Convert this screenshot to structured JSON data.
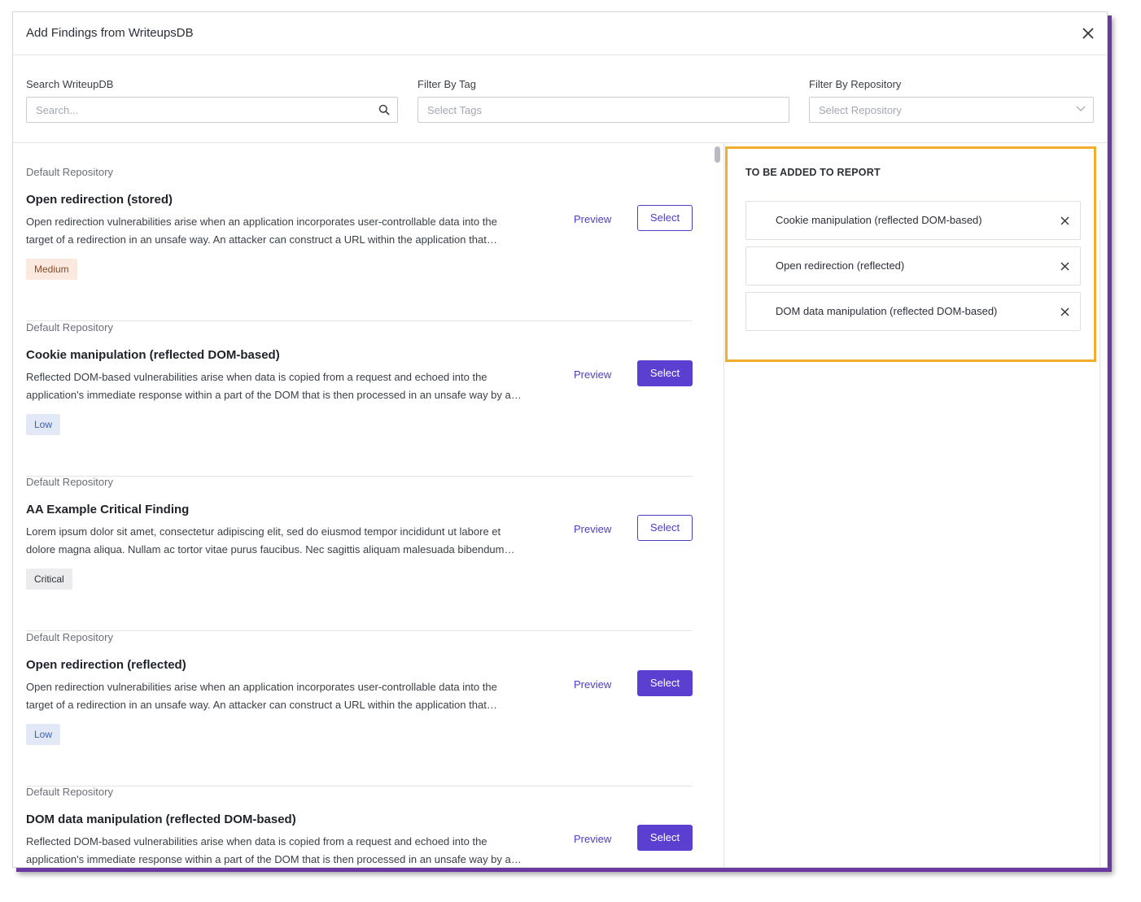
{
  "modal": {
    "title": "Add Findings from WriteupsDB",
    "close_icon": "close-icon"
  },
  "filters": {
    "search": {
      "label": "Search WriteupDB",
      "placeholder": "Search..."
    },
    "tag": {
      "label": "Filter By Tag",
      "placeholder": "Select Tags"
    },
    "repository": {
      "label": "Filter By Repository",
      "placeholder": "Select Repository"
    }
  },
  "findings": [
    {
      "repo": "Default Repository",
      "title": "Open redirection (stored)",
      "desc_line1": "Open redirection vulnerabilities arise when an application incorporates user-controllable data into the",
      "desc_line2": "target of a redirection in an unsafe way. An attacker can construct a URL within the application that…",
      "severity": "Medium",
      "preview": "Preview",
      "select": "Select",
      "selected": false
    },
    {
      "repo": "Default Repository",
      "title": "Cookie manipulation (reflected DOM-based)",
      "desc_line1": "Reflected DOM-based vulnerabilities arise when data is copied from a request and echoed into the",
      "desc_line2": "application's immediate response within a part of the DOM that is then processed in an unsafe way by a…",
      "severity": "Low",
      "preview": "Preview",
      "select": "Select",
      "selected": true
    },
    {
      "repo": "Default Repository",
      "title": "AA Example Critical Finding",
      "desc_line1": "Lorem ipsum dolor sit amet, consectetur adipiscing elit, sed do eiusmod tempor incididunt ut labore et",
      "desc_line2": "dolore magna aliqua. Nullam ac tortor vitae purus faucibus. Nec sagittis aliquam malesuada bibendum…",
      "severity": "Critical",
      "preview": "Preview",
      "select": "Select",
      "selected": false
    },
    {
      "repo": "Default Repository",
      "title": "Open redirection (reflected)",
      "desc_line1": "Open redirection vulnerabilities arise when an application incorporates user-controllable data into the",
      "desc_line2": "target of a redirection in an unsafe way. An attacker can construct a URL within the application that…",
      "severity": "Low",
      "preview": "Preview",
      "select": "Select",
      "selected": true
    },
    {
      "repo": "Default Repository",
      "title": "DOM data manipulation (reflected DOM-based)",
      "desc_line1": "Reflected DOM-based vulnerabilities arise when data is copied from a request and echoed into the",
      "desc_line2": "application's immediate response within a part of the DOM that is then processed in an unsafe way by a…",
      "severity": "",
      "preview": "Preview",
      "select": "Select",
      "selected": true
    }
  ],
  "to_be_added": {
    "heading": "TO BE ADDED TO REPORT",
    "items": [
      {
        "label": "Cookie manipulation (reflected DOM-based)"
      },
      {
        "label": "Open redirection (reflected)"
      },
      {
        "label": "DOM data manipulation (reflected DOM-based)"
      }
    ]
  },
  "colors": {
    "accent": "#5b3fd1",
    "highlight": "#f1ad2e",
    "medium_badge_bg": "#fbe9df",
    "low_badge_bg": "#e2e8f6",
    "critical_badge_bg": "#ececee"
  }
}
